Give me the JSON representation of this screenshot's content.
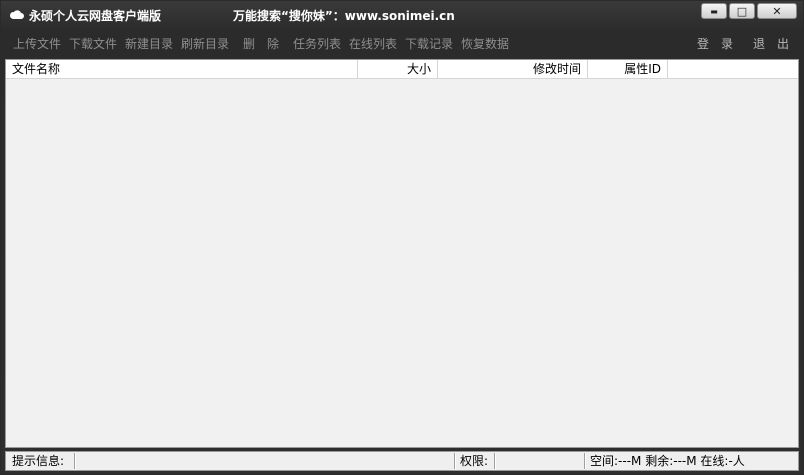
{
  "window": {
    "title": "永硕个人云网盘客户端版",
    "slogan": "万能搜索“搜你妹”：www.sonimei.cn",
    "controls": {
      "minimize": "▬",
      "maximize": "□",
      "close": "✕"
    }
  },
  "toolbar": {
    "upload": "上传文件",
    "download": "下载文件",
    "new_dir": "新建目录",
    "refresh_dir": "刷新目录",
    "delete": "删　除",
    "task_list": "任务列表",
    "online_list": "在线列表",
    "download_log": "下载记录",
    "restore_data": "恢复数据",
    "login": "登　录",
    "logout": "退　出"
  },
  "file_list": {
    "columns": [
      "文件名称",
      "大小",
      "修改时间",
      "属性ID"
    ],
    "rows": []
  },
  "statusbar": {
    "hint_label": "提示信息:",
    "hint_value": "",
    "permission_label": "权限:",
    "permission_value": "",
    "space_info": "空间:---M 剩余:---M 在线:-人"
  }
}
